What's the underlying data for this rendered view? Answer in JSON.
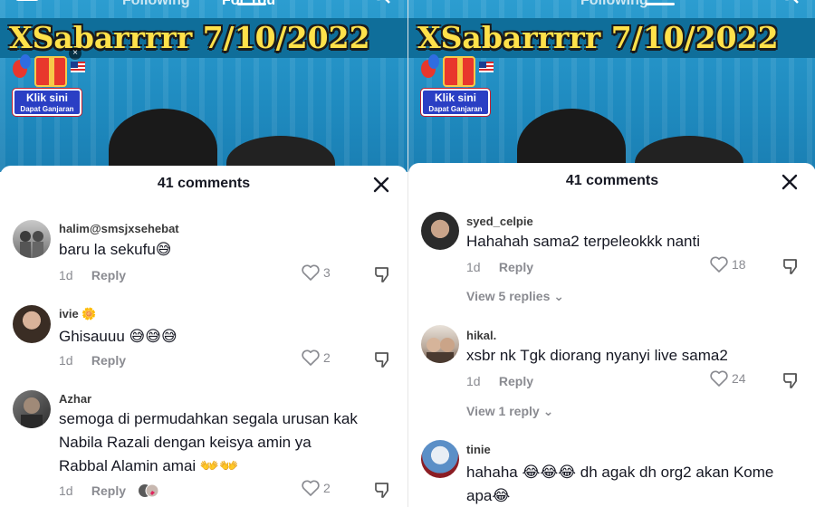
{
  "top_nav": {
    "following": "Following",
    "for_you": "For You"
  },
  "video": {
    "banner_text": "XSabarrrrr 7/10/2022",
    "gift_close": "×",
    "gift_line1": "Klik sini",
    "gift_line2": "Dapat Ganjaran"
  },
  "left": {
    "title": "41 comments",
    "comments": [
      {
        "username": "halim@smsjxsehebat",
        "text": "baru la sekufu😅",
        "time": "1d",
        "reply": "Reply",
        "likes": "3"
      },
      {
        "username": "ivie 🌼",
        "text": "Ghisauuu 😅😅😅",
        "time": "1d",
        "reply": "Reply",
        "likes": "2"
      },
      {
        "username": "Azhar",
        "text": "semoga di permudahkan segala urusan kak Nabila Razali dengan keisya amin ya Rabbal Alamin amai 👐👐",
        "time": "1d",
        "reply": "Reply",
        "likes": "2"
      }
    ]
  },
  "right": {
    "title": "41 comments",
    "comments": [
      {
        "username": "syed_celpie",
        "text": "Hahahah sama2 terpeleokkk nanti",
        "time": "1d",
        "reply": "Reply",
        "likes": "18",
        "view_replies": "View 5 replies ⌄"
      },
      {
        "username": "hikal.",
        "text": "xsbr nk Tgk diorang nyanyi live sama2",
        "time": "1d",
        "reply": "Reply",
        "likes": "24",
        "view_replies": "View 1 reply ⌄"
      },
      {
        "username": "tinie",
        "text": "hahaha 😂😂😂 dh agak dh org2 akan Kome apa😂"
      }
    ]
  },
  "colors": {
    "video_blue": "#1f8bc0",
    "banner_yellow": "#ffe14a",
    "text_dark": "#161823",
    "muted_gray": "#8a8b91"
  },
  "icons": [
    "live-icon",
    "search-icon",
    "close-icon",
    "heart-icon",
    "dislike-icon",
    "gift-icon"
  ]
}
